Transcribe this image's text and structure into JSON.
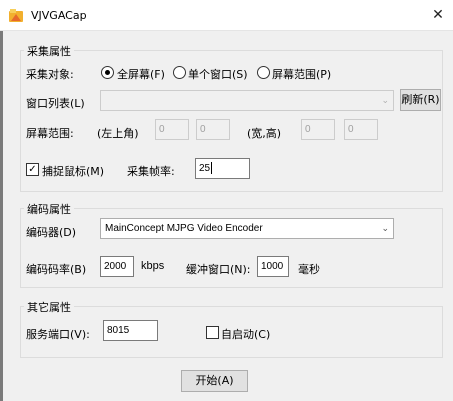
{
  "window": {
    "title": "VJVGACap",
    "close_glyph": "✕"
  },
  "capture": {
    "group_title": "采集属性",
    "target_label": "采集对象:",
    "options": [
      "全屏幕(F)",
      "单个窗口(S)",
      "屏幕范围(P)"
    ],
    "selected_option": "全屏幕(F)",
    "window_list_label": "窗口列表(L)",
    "window_list_value": "",
    "refresh_label": "刷新(R)",
    "range_label": "屏幕范围:",
    "top_left_label": "(左上角)",
    "x": "0",
    "y": "0",
    "size_label": "(宽,高)",
    "width": "0",
    "height": "0",
    "capture_mouse_label": "捕捉鼠标(M)",
    "capture_mouse_checked": true,
    "frame_rate_label": "采集帧率:",
    "frame_rate": "25"
  },
  "encoding": {
    "group_title": "编码属性",
    "encoder_label": "编码器(D)",
    "encoder_value": "MainConcept MJPG Video Encoder",
    "bitrate_label": "编码码率(B)",
    "bitrate": "2000",
    "bitrate_unit": "kbps",
    "buffer_label": "缓冲窗口(N):",
    "buffer": "1000",
    "buffer_unit": "毫秒"
  },
  "other": {
    "group_title": "其它属性",
    "port_label": "服务端口(V):",
    "port": "8015",
    "autostart_label": "自启动(C)",
    "autostart_checked": false
  },
  "start_label": "开始(A)"
}
